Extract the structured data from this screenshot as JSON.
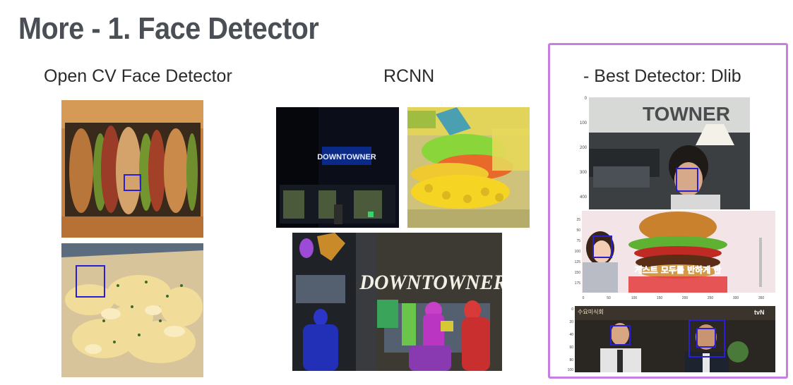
{
  "slide": {
    "title": "More - 1. Face Detector"
  },
  "columns": [
    {
      "label": "Open CV Face Detector"
    },
    {
      "label": "RCNN"
    },
    {
      "label": "- Best Detector: Dlib"
    }
  ],
  "photos": {
    "rcnn_sign_text": "DOWNTOWNER",
    "rcnn_storefront_text": "DOWNTOWNER",
    "dlib_sign_text": "TOWNER",
    "dlib_burger_caption": "게스트 모두를 반하게 한",
    "dlib_tv_channel": "tvN",
    "dlib_tv_title": "수요미식회"
  },
  "dlib_axis_ticks": {
    "plot1_y": [
      "0",
      "100",
      "200",
      "300",
      "400"
    ],
    "plot2_y": [
      "25",
      "50",
      "75",
      "100",
      "125",
      "150",
      "175"
    ],
    "plot2_x": [
      "0",
      "50",
      "100",
      "150",
      "200",
      "250",
      "300",
      "350"
    ],
    "plot3_y": [
      "0",
      "20",
      "40",
      "60",
      "80",
      "100"
    ]
  },
  "colors": {
    "title": "#4a4f55",
    "highlight_frame": "#c77fe0",
    "detection_box": "#2a1fd6"
  }
}
